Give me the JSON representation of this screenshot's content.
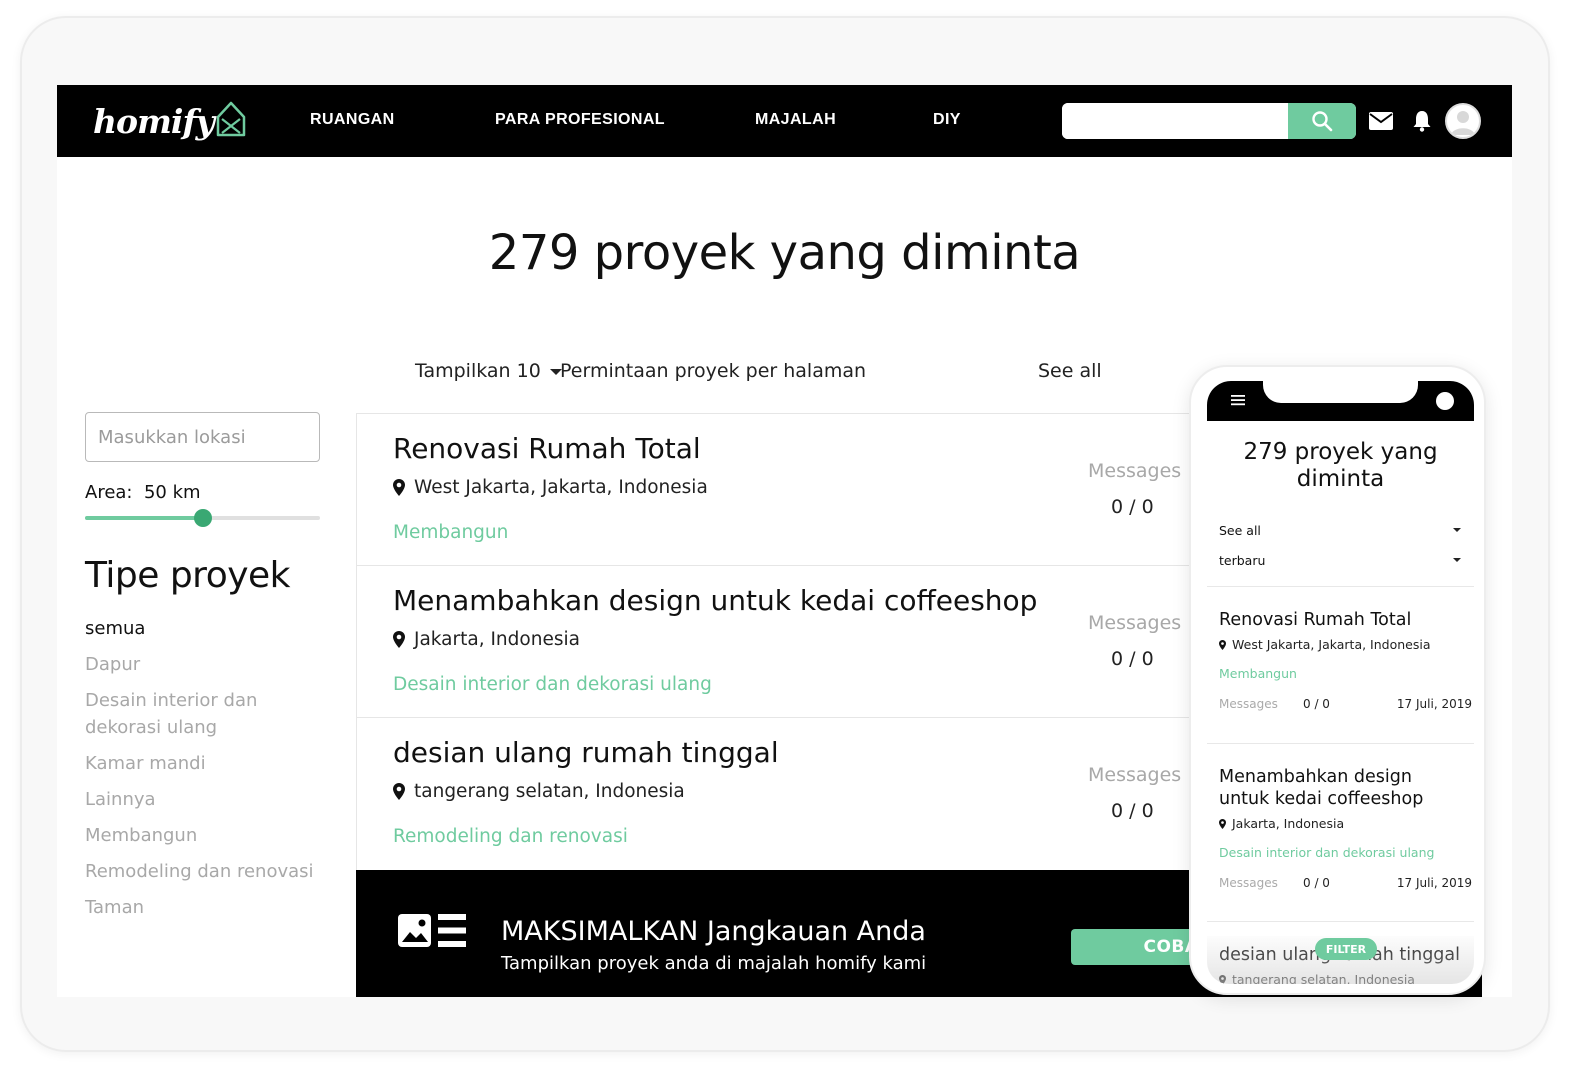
{
  "brand": {
    "logo_text": "homify",
    "accent_color": "#6fcb9f",
    "dark_color": "#000000"
  },
  "nav": {
    "links": [
      "RUANGAN",
      "PARA PROFESIONAL",
      "MAJALAH",
      "DIY"
    ],
    "search": {
      "value": "",
      "placeholder": ""
    },
    "icons": [
      "search-icon",
      "mail-icon",
      "bell-icon",
      "avatar"
    ]
  },
  "main": {
    "title": "279 proyek yang diminta",
    "pager": {
      "prefix": "Tampilkan",
      "selected": "10",
      "suffix": "Permintaan proyek per halaman",
      "see_all": "See all"
    }
  },
  "sidebar": {
    "location": {
      "value": "",
      "placeholder": "Masukkan lokasi"
    },
    "area": {
      "label": "Area:",
      "value": "50 km",
      "slider_fraction": 0.5
    },
    "filter_heading": "Tipe proyek",
    "filters": [
      {
        "label": "semua",
        "active": true
      },
      {
        "label": "Dapur",
        "active": false
      },
      {
        "label": "Desain interior dan dekorasi ulang",
        "active": false
      },
      {
        "label": "Kamar mandi",
        "active": false
      },
      {
        "label": "Lainnya",
        "active": false
      },
      {
        "label": "Membangun",
        "active": false
      },
      {
        "label": "Remodeling dan renovasi",
        "active": false
      },
      {
        "label": "Taman",
        "active": false
      }
    ]
  },
  "projects": [
    {
      "title": "Renovasi Rumah Total",
      "location": "West Jakarta, Jakarta, Indonesia",
      "category": "Membangun",
      "messages_label": "Messages",
      "messages": "0 / 0"
    },
    {
      "title": "Menambahkan design untuk kedai coffeeshop",
      "location": "Jakarta, Indonesia",
      "category": "Desain interior dan dekorasi ulang",
      "messages_label": "Messages",
      "messages": "0 / 0"
    },
    {
      "title": "desian ulang rumah tinggal",
      "location": "tangerang selatan, Indonesia",
      "category": "Remodeling dan renovasi",
      "messages_label": "Messages",
      "messages": "0 / 0"
    }
  ],
  "promo": {
    "title": "MAKSIMALKAN Jangkauan Anda",
    "subtitle": "Tampilkan proyek anda di majalah homify kami",
    "button": "COBA"
  },
  "mobile": {
    "title": "279 proyek yang diminta",
    "select_1": "See all",
    "select_2": "terbaru",
    "cards": [
      {
        "title": "Renovasi Rumah Total",
        "location": "West Jakarta, Jakarta, Indonesia",
        "category": "Membangun",
        "messages_label": "Messages",
        "messages": "0 / 0",
        "date": "17 Juli, 2019"
      },
      {
        "title": "Menambahkan design untuk kedai coffeeshop",
        "location": "Jakarta, Indonesia",
        "category": "Desain interior dan dekorasi ulang",
        "messages_label": "Messages",
        "messages": "0 / 0",
        "date": "17 Juli, 2019"
      },
      {
        "title": "desian ulang rumah tinggal",
        "location": "tangerang selatan, Indonesia"
      }
    ],
    "filter_button": "FILTER"
  }
}
